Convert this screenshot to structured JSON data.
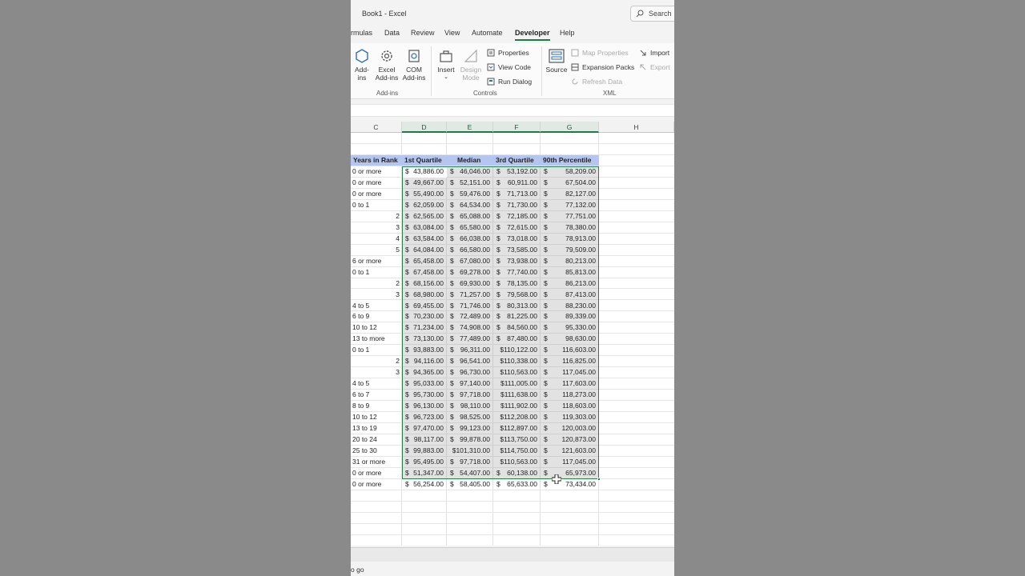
{
  "window": {
    "title": "Book1  -  Excel"
  },
  "search": {
    "label": "Search"
  },
  "tabs": [
    "rmulas",
    "Data",
    "Review",
    "View",
    "Automate",
    "Developer",
    "Help"
  ],
  "active_tab": "Developer",
  "ribbon": {
    "addins": {
      "addins": "Add-\nins",
      "excel_addins": "Excel\nAdd-ins",
      "com_addins": "COM\nAdd-ins",
      "label": "Add-ins"
    },
    "controls": {
      "insert": "Insert",
      "design_mode": "Design\nMode",
      "properties": "Properties",
      "view_code": "View Code",
      "run_dialog": "Run Dialog",
      "label": "Controls"
    },
    "xml": {
      "source": "Source",
      "map_properties": "Map Properties",
      "expansion_packs": "Expansion Packs",
      "refresh_data": "Refresh Data",
      "import": "Import",
      "export": "Export",
      "label": "XML"
    }
  },
  "columns": [
    "C",
    "D",
    "E",
    "F",
    "G",
    "H"
  ],
  "headers": [
    "Years in Rank",
    "1st Quartile",
    "Median",
    "3rd Quartile",
    "90th Percentile"
  ],
  "rows": [
    [
      "0 or more",
      "43,886.00",
      "46,046.00",
      "53,192.00",
      "58,209.00"
    ],
    [
      "0 or more",
      "49,667.00",
      "52,151.00",
      "60,911.00",
      "67,504.00"
    ],
    [
      "0 or more",
      "55,490.00",
      "59,476.00",
      "71,713.00",
      "82,127.00"
    ],
    [
      "0 to 1",
      "62,059.00",
      "64,534.00",
      "71,730.00",
      "77,132.00"
    ],
    [
      "2",
      "62,565.00",
      "65,088.00",
      "72,185.00",
      "77,751.00"
    ],
    [
      "3",
      "63,084.00",
      "65,580.00",
      "72,615.00",
      "78,380.00"
    ],
    [
      "4",
      "63,584.00",
      "66,038.00",
      "73,018.00",
      "78,913.00"
    ],
    [
      "5",
      "64,084.00",
      "66,580.00",
      "73,585.00",
      "79,509.00"
    ],
    [
      "6 or more",
      "65,458.00",
      "67,080.00",
      "73,938.00",
      "80,213.00"
    ],
    [
      "0 to 1",
      "67,458.00",
      "69,278.00",
      "77,740.00",
      "85,813.00"
    ],
    [
      "2",
      "68,156.00",
      "69,930.00",
      "78,135.00",
      "86,213.00"
    ],
    [
      "3",
      "68,980.00",
      "71,257.00",
      "79,568.00",
      "87,413.00"
    ],
    [
      "4 to 5",
      "69,455.00",
      "71,746.00",
      "80,313.00",
      "88,230.00"
    ],
    [
      "6 to 9",
      "70,230.00",
      "72,489.00",
      "81,225.00",
      "89,339.00"
    ],
    [
      "10 to 12",
      "71,234.00",
      "74,908.00",
      "84,560.00",
      "95,330.00"
    ],
    [
      "13 to more",
      "73,130.00",
      "77,489.00",
      "87,480.00",
      "98,630.00"
    ],
    [
      "0 to 1",
      "93,883.00",
      "96,311.00",
      "$110,122.00",
      "116,603.00"
    ],
    [
      "2",
      "94,116.00",
      "96,541.00",
      "$110,338.00",
      "116,825.00"
    ],
    [
      "3",
      "94,365.00",
      "96,730.00",
      "$110,563.00",
      "117,045.00"
    ],
    [
      "4 to 5",
      "95,033.00",
      "97,140.00",
      "$111,005.00",
      "117,603.00"
    ],
    [
      "6 to 7",
      "95,730.00",
      "97,718.00",
      "$111,638.00",
      "118,273.00"
    ],
    [
      "8 to 9",
      "96,130.00",
      "98,110.00",
      "$111,902.00",
      "118,603.00"
    ],
    [
      "10 to 12",
      "96,723.00",
      "98,525.00",
      "$112,208.00",
      "119,303.00"
    ],
    [
      "13 to 19",
      "97,470.00",
      "99,123.00",
      "$112,897.00",
      "120,003.00"
    ],
    [
      "20 to 24",
      "98,117.00",
      "99,878.00",
      "$113,750.00",
      "120,873.00"
    ],
    [
      "25 to 30",
      "99,883.00",
      "$101,310.00",
      "$114,750.00",
      "121,603.00"
    ],
    [
      "31 or more",
      "95,495.00",
      "97,718.00",
      "$110,563.00",
      "117,045.00"
    ],
    [
      "0 or more",
      "51,347.00",
      "54,407.00",
      "60,138.00",
      "65,973.00"
    ],
    [
      "0 or more",
      "56,254.00",
      "58,405.00",
      "65,633.00",
      "73,434.00"
    ]
  ],
  "dollar_sign": "$",
  "status": {
    "text": "o go"
  },
  "colors": {
    "accent": "#1f7a43",
    "header_fill": "#b4c6f0",
    "selection": "#2f7d4d"
  }
}
